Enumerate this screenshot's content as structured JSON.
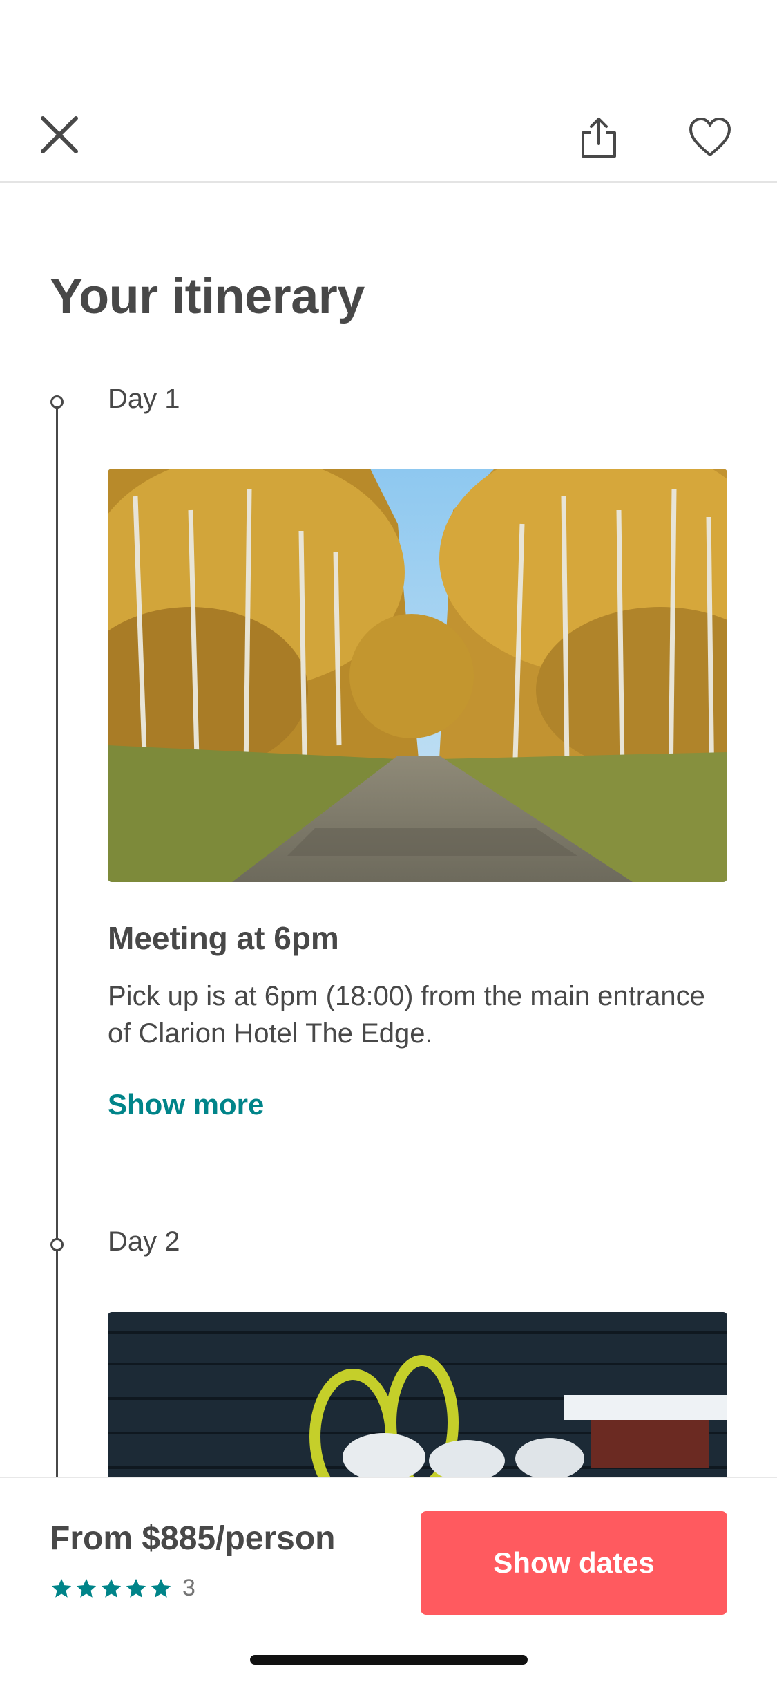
{
  "header": {
    "close_icon": "close-icon",
    "share_icon": "share-icon",
    "favorite_icon": "heart-icon"
  },
  "page": {
    "title": "Your itinerary"
  },
  "itinerary": [
    {
      "day": "Day 1",
      "image": "autumn-forest-road-photo",
      "title": "Meeting at 6pm",
      "description": "Pick up is at 6pm (18:00) from the main entrance of Clarion Hotel The Edge.",
      "show_more": "Show more"
    },
    {
      "day": "Day 2",
      "image": "snowshoes-on-cabin-wall-photo"
    }
  ],
  "footer": {
    "price": "From $885/person",
    "rating_stars": 5,
    "review_count": "3",
    "button_label": "Show dates"
  },
  "colors": {
    "accent": "#008489",
    "cta": "#ff5a5f",
    "text": "#484848"
  }
}
